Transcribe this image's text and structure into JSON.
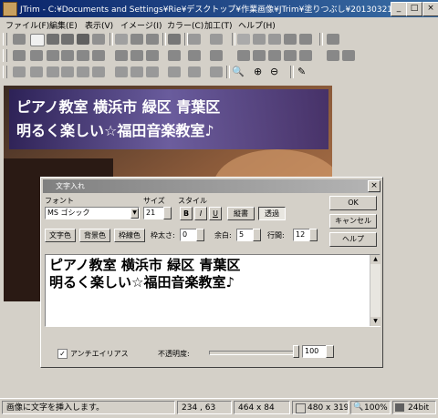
{
  "window": {
    "title": "JTrim - C:¥Documents and Settings¥Rie¥デスクトップ¥作業画像¥JTrim¥塗りつぶし¥20130321-01.jpg",
    "minimize": "_",
    "maximize": "□",
    "close": "×"
  },
  "menu": [
    "ファイル(F)",
    "編集(E)",
    "表示(V)",
    "イメージ(I)",
    "カラー(C)",
    "加工(T)",
    "ヘルプ(H)"
  ],
  "canvas": {
    "overlay_line1": "ピアノ教室 横浜市 緑区 青葉区",
    "overlay_line2": "明るく楽しい☆福田音楽教室♪"
  },
  "dialog": {
    "title": "文字入れ",
    "close": "×",
    "font_label": "フォント",
    "font_value": "MS ゴシック",
    "size_label": "サイズ",
    "size_value": "21",
    "style_label": "スタイル",
    "bold": "B",
    "italic": "I",
    "underline": "U",
    "vertical": "縦書",
    "transparent": "透過",
    "ok": "OK",
    "cancel": "キャンセル",
    "help": "ヘルプ",
    "text_color": "文字色",
    "bg_color": "背景色",
    "border_color": "枠線色",
    "border_width_label": "枠太さ:",
    "border_width_value": "0",
    "margin_label": "余白:",
    "margin_value": "5",
    "line_spacing_label": "行間:",
    "line_spacing_value": "12",
    "text_line1": "ピアノ教室 横浜市 緑区 青葉区",
    "text_line2": "明るく楽しい☆福田音楽教室♪",
    "antialias_label": "アンチエイリアス",
    "opacity_label": "不透明度:",
    "opacity_value": "100",
    "opacity_level": 1.0
  },
  "status": {
    "message": "画像に文字を挿入します。",
    "coords": "234 , 63",
    "selection": "464 x 84",
    "image_size": "480 x 319",
    "zoom": "100%",
    "depth": "24bit"
  },
  "colors": {
    "title_bg": "#0a246a",
    "face": "#d4d0c8",
    "text_overlay_bg": "#4a3a8a"
  }
}
